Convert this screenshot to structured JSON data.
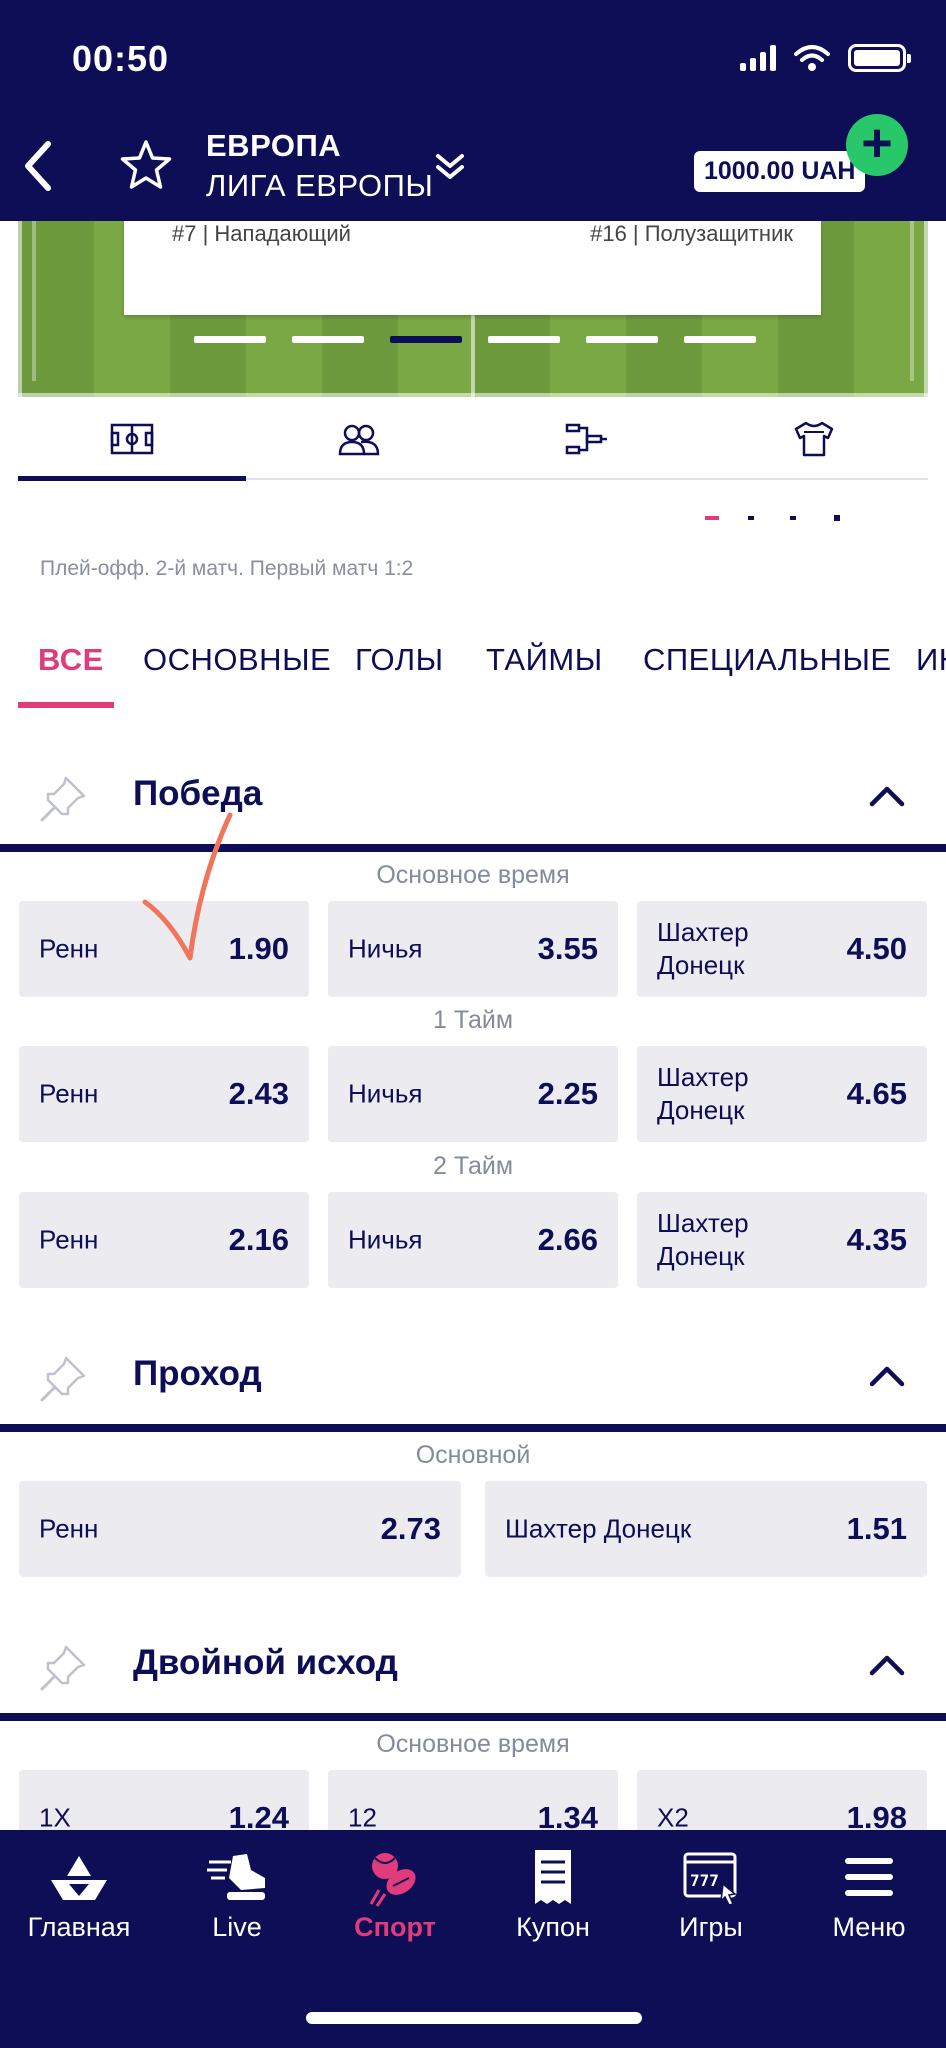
{
  "status_bar": {
    "time": "00:50"
  },
  "header": {
    "title_line1": "ЕВРОПА",
    "title_line2": "ЛИГА ЕВРОПЫ",
    "balance": "1000.00 UAH"
  },
  "lineup": {
    "player_left": "#7 | Нападающий",
    "player_right": "#16 | Полузащитник",
    "carousel_active_index": 3,
    "carousel_count": 6
  },
  "icon_tabs": [
    "field-icon",
    "players-icon",
    "bracket-icon",
    "jersey-icon"
  ],
  "match_info": "Плей-офф. 2-й матч. Первый матч 1:2",
  "categories": {
    "active": "ВСЕ",
    "items": [
      "ВСЕ",
      "ОСНОВНЫЕ",
      "ГОЛЫ",
      "ТАЙМЫ",
      "СПЕЦИАЛЬНЫЕ",
      "ИН"
    ]
  },
  "markets": {
    "win": {
      "title": "Победа",
      "rows": [
        {
          "label": "Основное время",
          "outcomes": [
            {
              "name": "Ренн",
              "odd": "1.90"
            },
            {
              "name": "Ничья",
              "odd": "3.55"
            },
            {
              "name": "Шахтер Донецк",
              "odd": "4.50"
            }
          ]
        },
        {
          "label": "1 Тайм",
          "outcomes": [
            {
              "name": "Ренн",
              "odd": "2.43"
            },
            {
              "name": "Ничья",
              "odd": "2.25"
            },
            {
              "name": "Шахтер Донецк",
              "odd": "4.65"
            }
          ]
        },
        {
          "label": "2 Тайм",
          "outcomes": [
            {
              "name": "Ренн",
              "odd": "2.16"
            },
            {
              "name": "Ничья",
              "odd": "2.66"
            },
            {
              "name": "Шахтер Донецк",
              "odd": "4.35"
            }
          ]
        }
      ]
    },
    "pass": {
      "title": "Проход",
      "rows": [
        {
          "label": "Основной",
          "outcomes": [
            {
              "name": "Ренн",
              "odd": "2.73"
            },
            {
              "name": "Шахтер Донецк",
              "odd": "1.51"
            }
          ]
        }
      ]
    },
    "double": {
      "title": "Двойной исход",
      "rows": [
        {
          "label": "Основное время",
          "outcomes": [
            {
              "name": "1X",
              "odd": "1.24"
            },
            {
              "name": "12",
              "odd": "1.34"
            },
            {
              "name": "X2",
              "odd": "1.98"
            }
          ]
        }
      ]
    }
  },
  "bottom_nav": {
    "active": "Спорт",
    "items": [
      {
        "label": "Главная",
        "icon": "home-logo-icon"
      },
      {
        "label": "Live",
        "icon": "running-shoe-icon"
      },
      {
        "label": "Спорт",
        "icon": "sports-balls-icon"
      },
      {
        "label": "Купон",
        "icon": "receipt-icon"
      },
      {
        "label": "Игры",
        "icon": "slot-machine-icon"
      },
      {
        "label": "Меню",
        "icon": "hamburger-menu-icon"
      }
    ]
  },
  "colors": {
    "navy": "#0d0e56",
    "accent_pink": "#e03b7a",
    "plus_green": "#28c76a",
    "odd_bg": "#ececf0"
  }
}
